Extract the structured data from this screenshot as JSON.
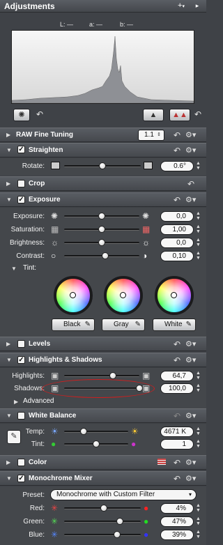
{
  "window": {
    "title": "Adjustments",
    "add_label": "+",
    "add_caret": "▾",
    "close_glyph": "▸"
  },
  "histogram": {
    "L": "L: —",
    "a": "a: —",
    "b": "b: —"
  },
  "sections": {
    "raw": {
      "title": "RAW Fine Tuning",
      "version": "1.1"
    },
    "straighten": {
      "title": "Straighten",
      "checked": true,
      "rotate_label": "Rotate:",
      "rotate_value": "0.6°",
      "rotate_level": 0.5
    },
    "crop": {
      "title": "Crop",
      "checked": false
    },
    "exposure": {
      "title": "Exposure",
      "checked": true,
      "rows": [
        {
          "label": "Exposure:",
          "value": "0,0",
          "level": 0.5
        },
        {
          "label": "Saturation:",
          "value": "1,00",
          "level": 0.5
        },
        {
          "label": "Brightness:",
          "value": "0,0",
          "level": 0.5
        },
        {
          "label": "Contrast:",
          "value": "0,10",
          "level": 0.55
        }
      ],
      "tint_label": "Tint:",
      "tint_buttons": [
        "Black",
        "Gray",
        "White"
      ]
    },
    "levels": {
      "title": "Levels",
      "checked": false
    },
    "highlights": {
      "title": "Highlights & Shadows",
      "checked": true,
      "rows": [
        {
          "label": "Highlights:",
          "value": "64,7",
          "level": 0.65
        },
        {
          "label": "Shadows:",
          "value": "100,0",
          "level": 1.0
        }
      ],
      "advanced_label": "Advanced"
    },
    "white_balance": {
      "title": "White Balance",
      "checked": false,
      "rows": [
        {
          "label": "Temp:",
          "value": "4671 K",
          "level": 0.3
        },
        {
          "label": "Tint:",
          "value": "1",
          "level": 0.5
        }
      ]
    },
    "color": {
      "title": "Color",
      "checked": false
    },
    "mono": {
      "title": "Monochrome Mixer",
      "checked": true,
      "preset_label": "Preset:",
      "preset_value": "Monochrome with Custom Filter",
      "rows": [
        {
          "label": "Red:",
          "value": "4%",
          "level": 0.52
        },
        {
          "label": "Green:",
          "value": "47%",
          "level": 0.73
        },
        {
          "label": "Blue:",
          "value": "39%",
          "level": 0.69
        }
      ]
    }
  },
  "colors": {
    "annotation": "#d42020",
    "panel": "#44474b",
    "header": "#52565b"
  }
}
